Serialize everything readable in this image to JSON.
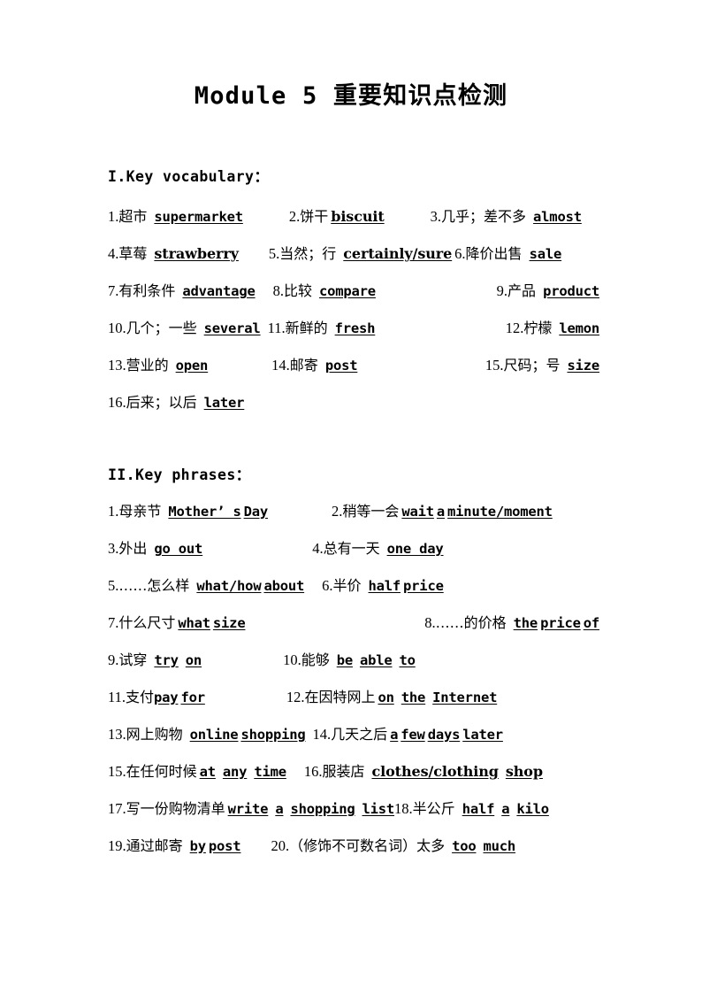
{
  "document": {
    "title": "Module 5 重要知识点检测"
  },
  "sections": [
    {
      "heading": "I.Key vocabulary：",
      "rows": [
        [
          {
            "num": "1.",
            "cn": "超市",
            "en": "supermarket"
          },
          {
            "num": "2.",
            "cn": "饼干",
            "en": "biscuit"
          },
          {
            "num": "3.",
            "cn": "几乎；差不多",
            "en": "almost"
          }
        ],
        [
          {
            "num": "4.",
            "cn": "草莓",
            "en": "strawberry"
          },
          {
            "num": "5.",
            "cn": "当然；行",
            "en": "certainly/sure"
          },
          {
            "num": "6.",
            "cn": "降价出售",
            "en": "sale"
          }
        ],
        [
          {
            "num": "7.",
            "cn": "有利条件",
            "en": "advantage"
          },
          {
            "num": "8.",
            "cn": "比较",
            "en": "compare"
          },
          {
            "num": "9.",
            "cn": "产品",
            "en": "product"
          }
        ],
        [
          {
            "num": "10.",
            "cn": "几个；一些",
            "en": "several"
          },
          {
            "num": "11.",
            "cn": "新鲜的",
            "en": "fresh"
          },
          {
            "num": "12.",
            "cn": "柠檬",
            "en": "lemon"
          }
        ],
        [
          {
            "num": "13.",
            "cn": "营业的",
            "en": "open "
          },
          {
            "num": "14.",
            "cn": "邮寄",
            "en": "post"
          },
          {
            "num": "15.",
            "cn": "尺码；号",
            "en": "size"
          }
        ],
        [
          {
            "num": "16.",
            "cn": "后来；以后",
            "en": "later"
          }
        ]
      ]
    },
    {
      "heading": "II.Key phrases：",
      "rows": [
        [
          {
            "num": "1.",
            "cn": "母亲节",
            "en": "Mother’ s",
            "en2": "Day"
          },
          {
            "num": "2.",
            "cn": "稍等一会",
            "en": "wait",
            "en2": "a",
            "en3": "minute/moment"
          }
        ],
        [
          {
            "num": "3.",
            "cn": "外出",
            "en": "go  out"
          },
          {
            "num": "4.",
            "cn": "总有一天",
            "en": "one  day"
          }
        ],
        [
          {
            "num": "5.",
            "cn": "……怎么样",
            "en": "what/how",
            "en2": " about"
          },
          {
            "num": "6.",
            "cn": "半价",
            "en": "half ",
            "en2": " price"
          }
        ],
        [
          {
            "num": "7.",
            "cn": "什么尺寸",
            "en": "what",
            "en2": "size"
          },
          {
            "num": "8.",
            "cn": "……的价格",
            "en": "the",
            "en2": "price",
            "en3": "of"
          }
        ],
        [
          {
            "num": "9.",
            "cn": "试穿",
            "en": "try",
            "en2": "on"
          },
          {
            "num": "10.",
            "cn": "能够",
            "en": "be",
            "en2": "able",
            "en3": "to"
          }
        ],
        [
          {
            "num": "11.",
            "cn": "支付",
            "en": "pay ",
            "en2": " for"
          },
          {
            "num": "12.",
            "cn": "在因特网上",
            "en": "on",
            "en2": "the",
            "en3": "Internet"
          }
        ],
        [
          {
            "num": "13.",
            "cn": "网上购物",
            "en": "online",
            "en2": "shopping"
          },
          {
            "num": "14.",
            "cn": "几天之后",
            "en": "a",
            "en2": "few",
            "en3": " days",
            "en4": " later"
          }
        ],
        [
          {
            "num": "15.",
            "cn": "在任何时候",
            "en": "at",
            "en2": "any",
            "en3": "time"
          },
          {
            "num": "16.",
            "cn": "服装店",
            "en": "clothes/clothing",
            "en2": "shop"
          }
        ],
        [
          {
            "num": "17.",
            "cn": "写一份购物清单",
            "en": "write",
            "en2": "a",
            "en3": "shopping",
            "en4": "list"
          },
          {
            "num": "18.",
            "cn": "半公斤",
            "en": "half",
            "en2": "a",
            "en3": "kilo"
          }
        ],
        [
          {
            "num": "19.",
            "cn": "通过邮寄",
            "en": "by",
            "en2": "post"
          },
          {
            "num": "20.",
            "cn": "（修饰不可数名词）太多",
            "en": "too",
            "en2": "much"
          }
        ]
      ]
    }
  ]
}
